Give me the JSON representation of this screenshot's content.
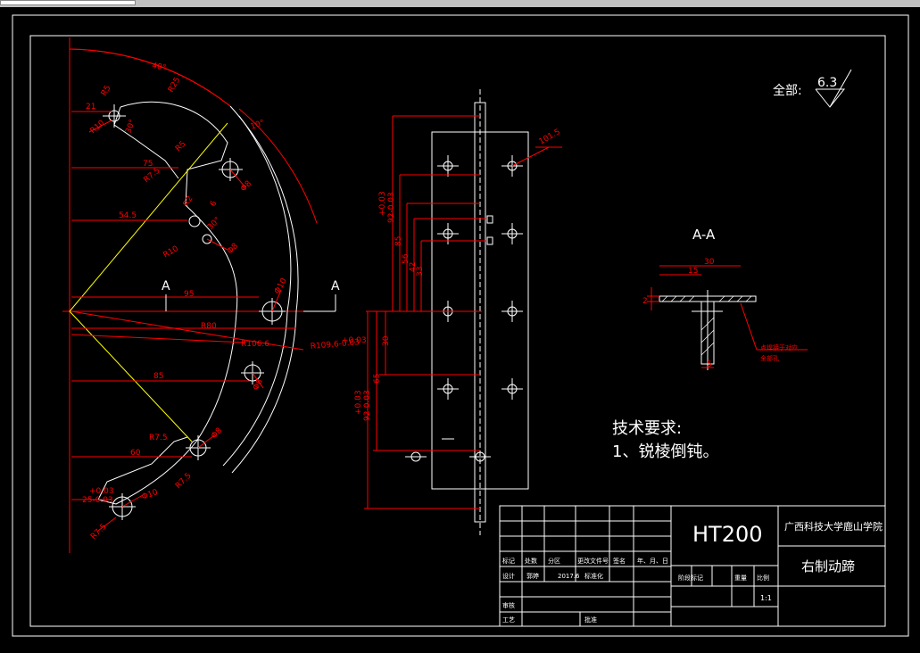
{
  "drawing": {
    "view_label_left": "A",
    "view_label_right": "A",
    "section_title": "A-A",
    "roughness": {
      "prefix": "全部:",
      "value": "6.3"
    },
    "tech_title": "技术要求:",
    "tech_item": "1、锐棱倒钝。",
    "dims_left": [
      "40°",
      "21",
      "R10",
      "R5",
      "30°",
      "R25",
      "10°",
      "75",
      "R7.5",
      "R5",
      "Φ8",
      "54.5",
      "R2",
      "6",
      "30°",
      "R10",
      "Φ8",
      "95",
      "Φ10",
      "R80",
      "R106.6",
      "R109.6-0.03",
      "+0.03",
      "85",
      "Φ8",
      "R7.5",
      "Φ8",
      "60",
      "R7.5",
      "+0.03",
      "25-0.03",
      "R7.5",
      "Φ10"
    ],
    "dims_middle": [
      "+0.03",
      "92-0.03",
      "85",
      "56",
      "42",
      "33",
      "30",
      "65",
      "+0.03",
      "92-0.03",
      "101.5"
    ],
    "dims_section": [
      "30",
      "15",
      "2",
      "5",
      "点焊接于对应",
      "全部孔"
    ]
  },
  "title_block": {
    "material": "HT200",
    "school": "广西科技大学鹿山学院",
    "part_name": "右制动蹄",
    "headers": [
      "标记",
      "处数",
      "分区",
      "更改文件号",
      "签名",
      "年、月、日"
    ],
    "row_design": [
      "设计",
      "郭婷",
      "2017.6",
      "标准化"
    ],
    "row_review": "审核",
    "row_process": "工艺",
    "row_approve": "批准",
    "stage_labels": [
      "阶段标记",
      "重量",
      "比例"
    ],
    "scale": "1:1"
  }
}
